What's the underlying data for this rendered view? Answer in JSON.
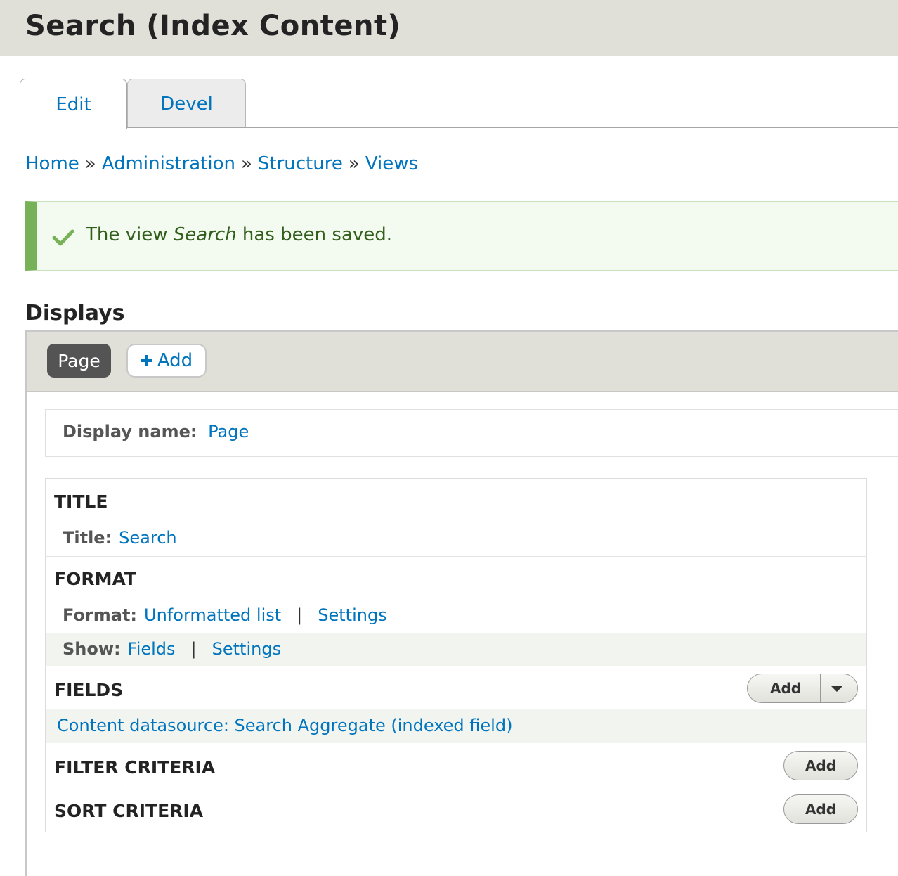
{
  "header": {
    "title": "Search (Index Content)"
  },
  "tabs": [
    {
      "label": "Edit",
      "active": true
    },
    {
      "label": "Devel",
      "active": false
    }
  ],
  "breadcrumb": {
    "items": [
      "Home",
      "Administration",
      "Structure",
      "Views"
    ],
    "separator": "»"
  },
  "message": {
    "prefix": "The view ",
    "view_name": "Search",
    "suffix": " has been saved.",
    "icon": "checkmark-icon",
    "status_color": "#77b259"
  },
  "displays": {
    "heading": "Displays",
    "active_display": "Page",
    "add_label": "Add",
    "add_icon": "plus-icon"
  },
  "display_name": {
    "label": "Display name:",
    "value": "Page"
  },
  "sections": {
    "title": {
      "heading": "TITLE",
      "label": "Title:",
      "value": "Search"
    },
    "format": {
      "heading": "FORMAT",
      "format_label": "Format:",
      "format_value": "Unformatted list",
      "format_settings": "Settings",
      "show_label": "Show:",
      "show_value": "Fields",
      "show_settings": "Settings"
    },
    "fields": {
      "heading": "FIELDS",
      "add_label": "Add",
      "dropdown_icon": "caret-down-icon",
      "items": [
        "Content datasource: Search Aggregate (indexed field)"
      ]
    },
    "filter": {
      "heading": "FILTER CRITERIA",
      "add_label": "Add"
    },
    "sort": {
      "heading": "SORT CRITERIA",
      "add_label": "Add"
    }
  },
  "colors": {
    "link": "#0074bd",
    "header_bg": "#e0e0d8",
    "message_bg": "#f3faef"
  }
}
